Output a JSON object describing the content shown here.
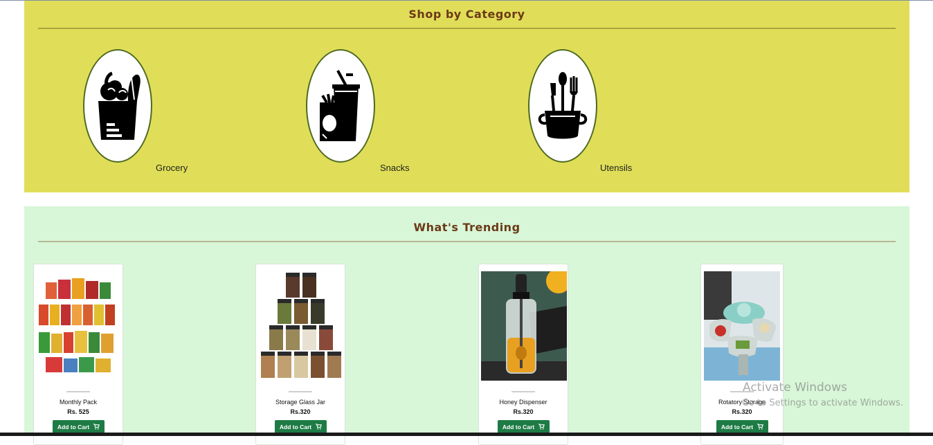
{
  "category_section": {
    "title": "Shop by Category",
    "items": [
      {
        "label": "Grocery",
        "icon": "grocery-bag-icon"
      },
      {
        "label": "Snacks",
        "icon": "snacks-drink-icon"
      },
      {
        "label": "Utensils",
        "icon": "utensils-pot-icon"
      }
    ]
  },
  "trending_section": {
    "title": "What's Trending",
    "products": [
      {
        "name": "Monthly Pack",
        "price": "Rs. 525",
        "button": "Add to Cart"
      },
      {
        "name": "Storage Glass Jar",
        "price": "Rs.320",
        "button": "Add to Cart"
      },
      {
        "name": "Honey Dispenser",
        "price": "Rs.320",
        "button": "Add to Cart"
      },
      {
        "name": "Rotatory Storage",
        "price": "Rs.320",
        "button": "Add to Cart"
      }
    ]
  },
  "watermark": {
    "line1": "Activate Windows",
    "line2": "Go to Settings to activate Windows."
  },
  "colors": {
    "category_bg": "#e0de58",
    "trending_bg": "#d8f6d8",
    "title_color": "#6b3a17",
    "button_bg": "#1e7b45"
  }
}
